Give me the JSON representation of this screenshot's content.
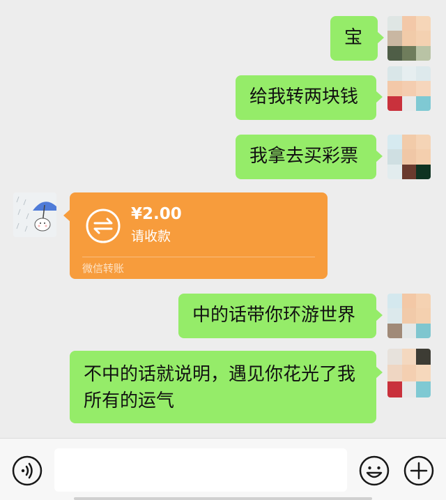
{
  "messages": [
    {
      "side": "right",
      "text": "宝"
    },
    {
      "side": "right",
      "text": "给我转两块钱"
    },
    {
      "side": "right",
      "text": "我拿去买彩票"
    },
    {
      "side": "left",
      "type": "transfer",
      "amount": "¥2.00",
      "status": "请收款",
      "footer": "微信转账"
    },
    {
      "side": "right",
      "text": "中的话带你环游世界"
    },
    {
      "side": "right",
      "text_line1": "不中的话就说明，遇见你花光了我",
      "text_line2": "所有的运气"
    }
  ],
  "colors": {
    "background": "#ededed",
    "bubble_green": "#95ec69",
    "transfer_orange": "#f79c3c",
    "bottom_bar": "#f7f7f7"
  },
  "icons": {
    "voice": "voice-input-icon",
    "emoji": "emoji-icon",
    "more": "plus-icon",
    "transfer": "transfer-arrows-icon"
  },
  "input": {
    "value": "",
    "placeholder": ""
  }
}
